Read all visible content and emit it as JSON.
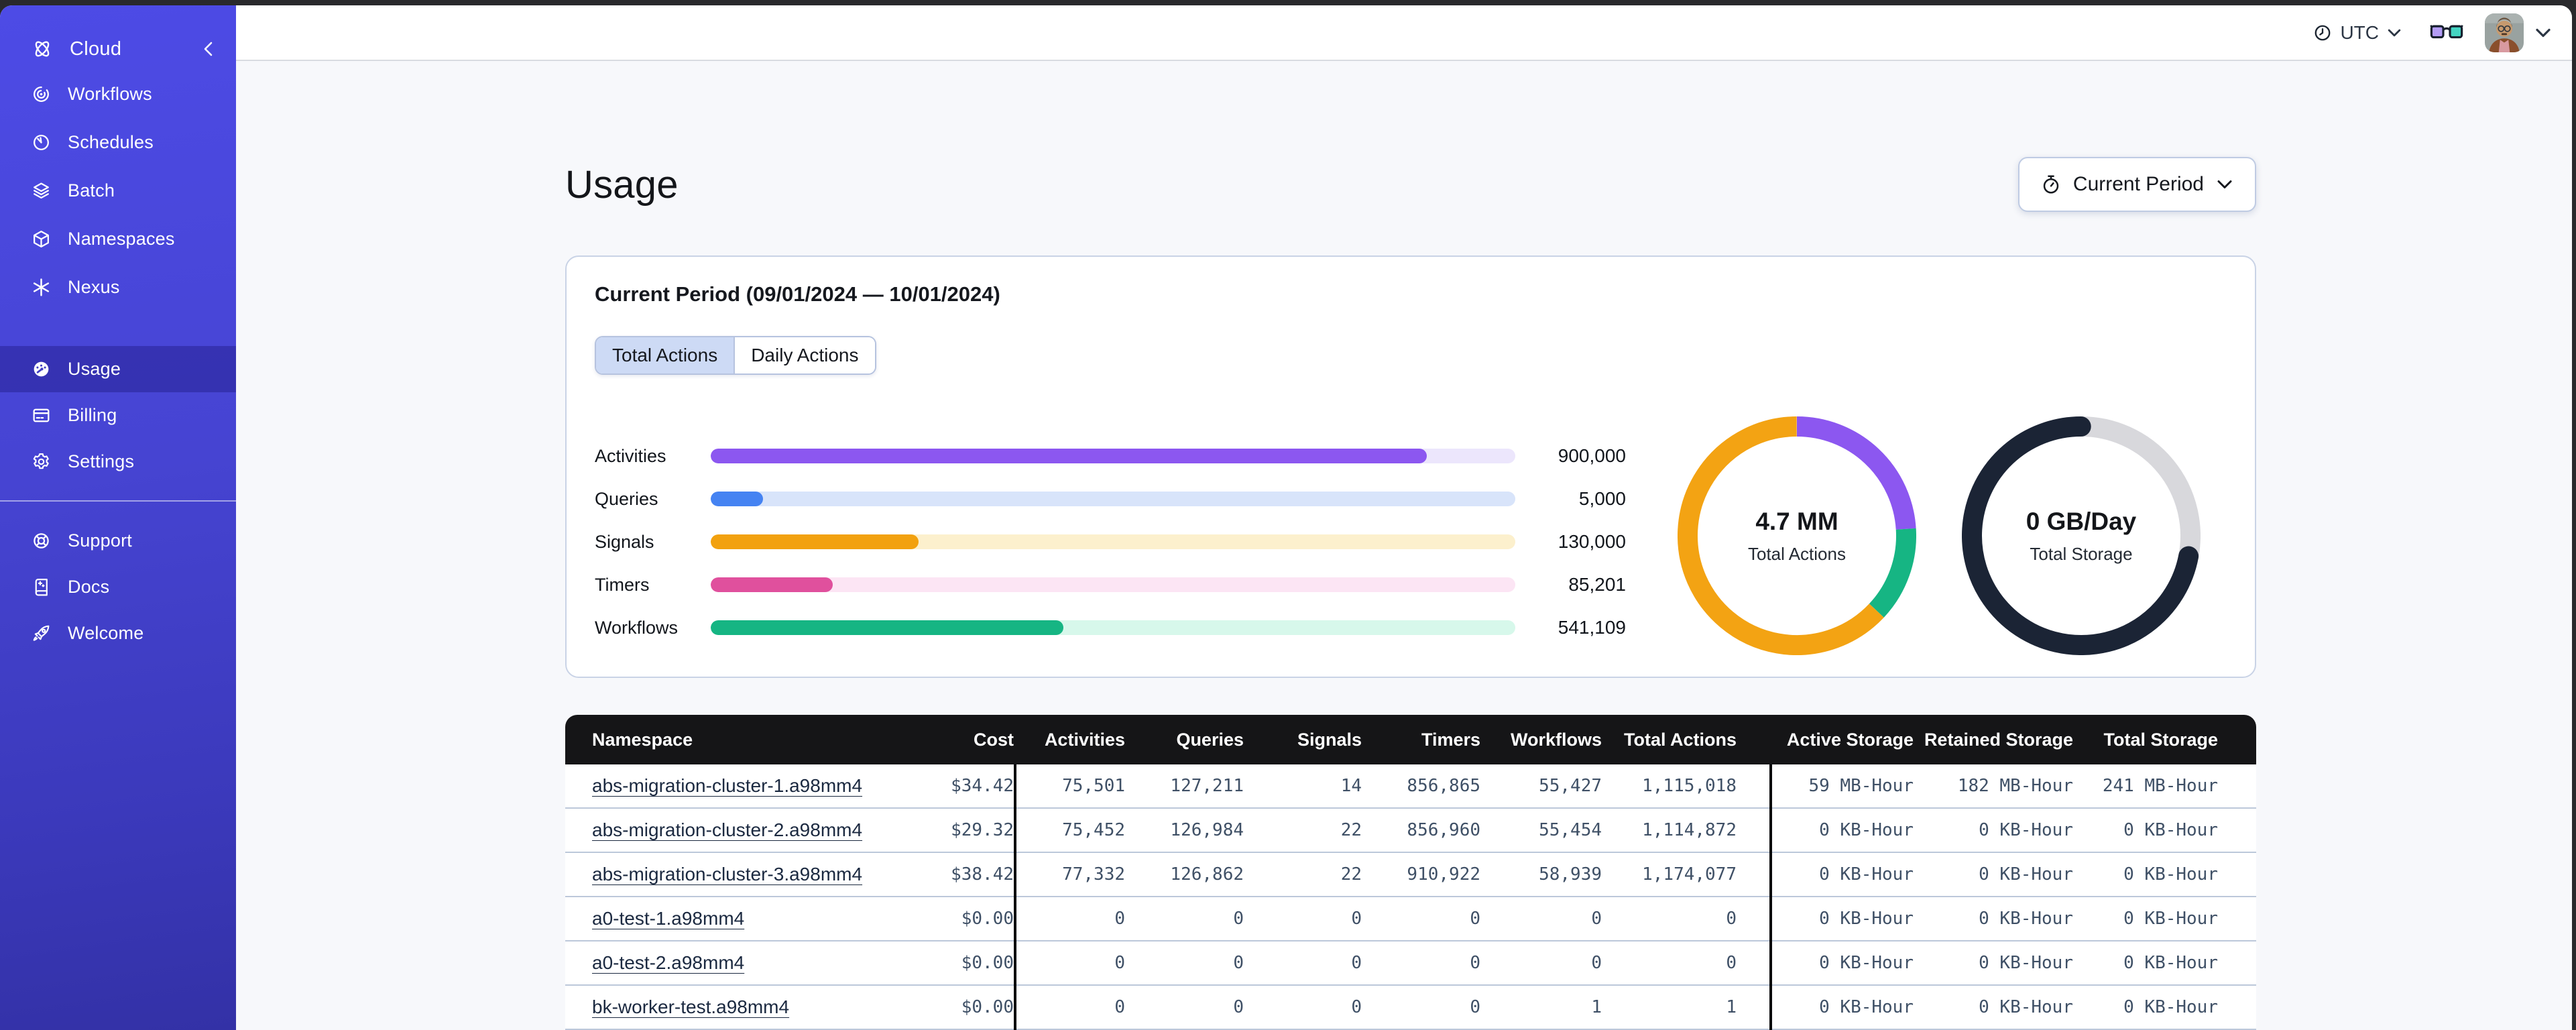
{
  "sidebar": {
    "header": {
      "label": "Cloud"
    },
    "nav_top": [
      {
        "label": "Workflows"
      },
      {
        "label": "Schedules"
      },
      {
        "label": "Batch"
      },
      {
        "label": "Namespaces"
      },
      {
        "label": "Nexus"
      }
    ],
    "nav_account": [
      {
        "label": "Usage",
        "active": true
      },
      {
        "label": "Billing",
        "active": false
      },
      {
        "label": "Settings",
        "active": false
      }
    ],
    "nav_footer": [
      {
        "label": "Support"
      },
      {
        "label": "Docs"
      },
      {
        "label": "Welcome"
      }
    ]
  },
  "topbar": {
    "timezone": "UTC"
  },
  "page": {
    "title": "Usage",
    "period_button_label": "Current Period"
  },
  "usage_card": {
    "title": "Current Period (09/01/2024 — 10/01/2024)",
    "tabs": [
      {
        "label": "Total Actions",
        "active": true
      },
      {
        "label": "Daily Actions",
        "active": false
      }
    ]
  },
  "chart_data": [
    {
      "type": "bar",
      "orientation": "horizontal",
      "categories": [
        "Activities",
        "Queries",
        "Signals",
        "Timers",
        "Workflows"
      ],
      "values": [
        900000,
        5000,
        130000,
        85201,
        541109
      ],
      "value_labels": [
        "900,000",
        "5,000",
        "130,000",
        "85,201",
        "541,109"
      ],
      "fill_percents": [
        89,
        6.5,
        25.8,
        15.2,
        43.8
      ],
      "colors": [
        "#8c57f0",
        "#4583f2",
        "#f2a10f",
        "#e0509d",
        "#16b583"
      ],
      "track_colors": [
        "#ece6fc",
        "#d8e4fa",
        "#fcf0cd",
        "#fce5f4",
        "#d7f8eb"
      ]
    },
    {
      "type": "donut",
      "center_label": "4.7 MM",
      "center_sublabel": "Total Actions",
      "segments": [
        {
          "name": "activities",
          "color": "#8c57f0",
          "percent": 24
        },
        {
          "name": "workflows",
          "color": "#16b583",
          "percent": 13
        },
        {
          "name": "other-actions",
          "color": "#f3a313",
          "percent": 63
        }
      ]
    },
    {
      "type": "donut",
      "center_label": "0 GB/Day",
      "center_sublabel": "Total Storage",
      "segments": [
        {
          "name": "remaining",
          "color": "#d8d8dc",
          "percent": 28
        },
        {
          "name": "used",
          "color": "#1b2435",
          "percent": 72,
          "cap": "round"
        }
      ]
    }
  ],
  "table": {
    "columns": [
      "Namespace",
      "Cost",
      "Activities",
      "Queries",
      "Signals",
      "Timers",
      "Workflows",
      "Total Actions",
      "Active Storage",
      "Retained Storage",
      "Total Storage"
    ],
    "rows": [
      [
        "abs-migration-cluster-1.a98mm4",
        "$34.42",
        "75,501",
        "127,211",
        "14",
        "856,865",
        "55,427",
        "1,115,018",
        "59 MB-Hour",
        "182 MB-Hour",
        "241 MB-Hour"
      ],
      [
        "abs-migration-cluster-2.a98mm4",
        "$29.32",
        "75,452",
        "126,984",
        "22",
        "856,960",
        "55,454",
        "1,114,872",
        "0 KB-Hour",
        "0 KB-Hour",
        "0 KB-Hour"
      ],
      [
        "abs-migration-cluster-3.a98mm4",
        "$38.42",
        "77,332",
        "126,862",
        "22",
        "910,922",
        "58,939",
        "1,174,077",
        "0 KB-Hour",
        "0 KB-Hour",
        "0 KB-Hour"
      ],
      [
        "a0-test-1.a98mm4",
        "$0.00",
        "0",
        "0",
        "0",
        "0",
        "0",
        "0",
        "0 KB-Hour",
        "0 KB-Hour",
        "0 KB-Hour"
      ],
      [
        "a0-test-2.a98mm4",
        "$0.00",
        "0",
        "0",
        "0",
        "0",
        "0",
        "0",
        "0 KB-Hour",
        "0 KB-Hour",
        "0 KB-Hour"
      ],
      [
        "bk-worker-test.a98mm4",
        "$0.00",
        "0",
        "0",
        "0",
        "0",
        "1",
        "1",
        "0 KB-Hour",
        "0 KB-Hour",
        "0 KB-Hour"
      ]
    ]
  }
}
